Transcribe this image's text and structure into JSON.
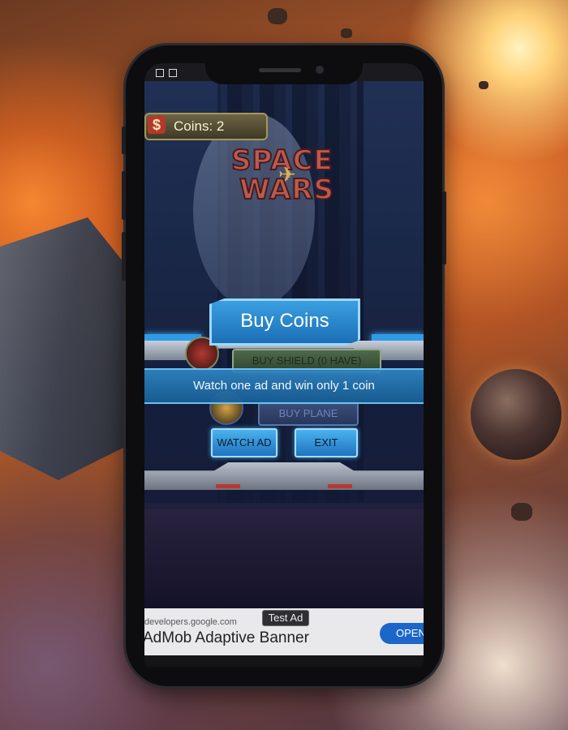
{
  "game": {
    "coins_label": "Coins: 2",
    "currency_symbol": "$",
    "logo_line1": "SPACE",
    "logo_line2": "WARS"
  },
  "dialog": {
    "title": "Buy Coins",
    "message": "Watch one ad and win only 1 coin",
    "watch_button": "WATCH AD",
    "exit_button": "EXIT"
  },
  "shop": {
    "shield_label": "BUY SHIELD (0 HAVE)",
    "plane_label": "BUY PLANE"
  },
  "ad": {
    "tag": "Test Ad",
    "url": "developers.google.com",
    "headline": "AdMob Adaptive Banner",
    "cta": "OPEN"
  },
  "colors": {
    "accent_blue": "#2f86c4",
    "ad_button": "#1c66c9"
  }
}
